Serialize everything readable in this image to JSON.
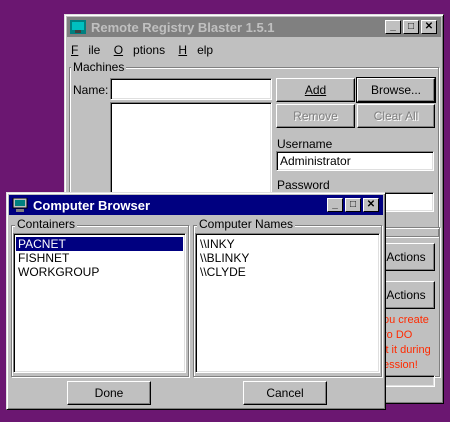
{
  "main_window": {
    "title": "Remote Registry Blaster 1.5.1",
    "menu": [
      "File",
      "Options",
      "Help"
    ],
    "machines_group_label": "Machines",
    "name_label": "Name:",
    "name_value": "",
    "add_button": "Add",
    "browse_button": "Browse...",
    "remove_button": "Remove",
    "clear_all_button": "Clear All",
    "username_label": "Username",
    "username_value": "Administrator",
    "password_label": "Password",
    "password_value": "",
    "actions_button_1": "Actions",
    "actions_button_2": "Actions",
    "note_lines": [
      "ou create",
      "ro DO",
      "it it during",
      "ession!"
    ]
  },
  "dialog": {
    "title": "Computer Browser",
    "containers_label": "Containers",
    "containers": [
      "PACNET",
      "FISHNET",
      "WORKGROUP"
    ],
    "selected_container": "PACNET",
    "computer_names_label": "Computer Names",
    "computer_names": [
      "\\\\INKY",
      "\\\\BLINKY",
      "\\\\CLYDE"
    ],
    "done_button": "Done",
    "cancel_button": "Cancel"
  },
  "colors": {
    "desktop": "#6b1771",
    "active_title": "#000080",
    "inactive_title": "#808080",
    "note_red": "#ff2a00"
  }
}
